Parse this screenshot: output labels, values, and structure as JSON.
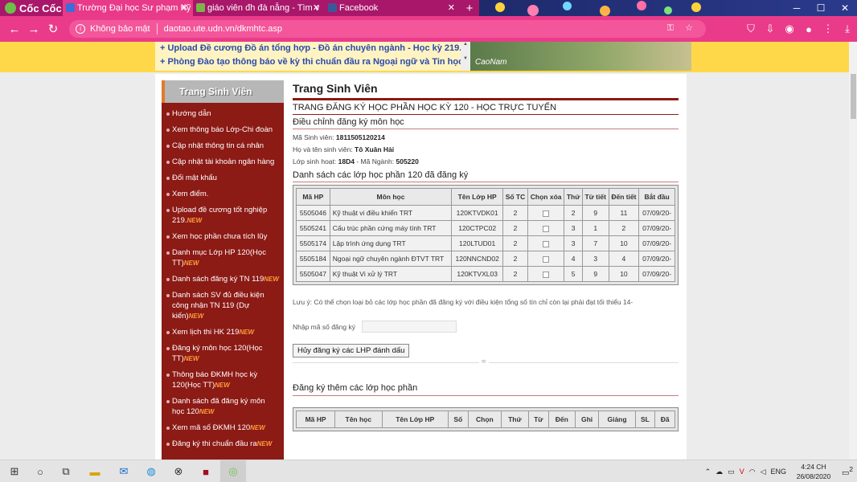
{
  "browser": {
    "brand": "Cốc Cốc",
    "tabs": [
      {
        "title": "Trường Đại học Sư phạm Kỹ t",
        "active": true,
        "icon_color": "#3a6ed8"
      },
      {
        "title": "giáo viên đh đà nẵng - Tìm v",
        "active": false,
        "icon_color": "#7ab648"
      },
      {
        "title": "Facebook",
        "active": false,
        "icon_color": "#3b5998"
      }
    ],
    "address": {
      "security_label": "Không bảo mật",
      "url": "daotao.ute.udn.vn/dkmhtc.asp"
    }
  },
  "banner": {
    "ticker": [
      "Upload Đề cương Đồ án tổng hợp - Đồ án chuyên ngành - Học kỳ 219.",
      "Phòng Đào tạo thông báo về kỳ thi chuẩn đầu ra Ngoại ngữ và Tin học đợ"
    ],
    "signature": "CaoNam"
  },
  "sidebar": {
    "title": "Trang Sinh Viên",
    "new_badge": "NEW",
    "items": [
      {
        "label": "Hướng dẫn",
        "new": false
      },
      {
        "label": "Xem thông báo Lớp-Chi đoàn",
        "new": false
      },
      {
        "label": "Cập nhật thông tin cá nhân",
        "new": false
      },
      {
        "label": "Cập nhật tài khoản ngân hàng",
        "new": false
      },
      {
        "label": "Đổi mật khẩu",
        "new": false
      },
      {
        "label": "Xem điểm.",
        "new": false
      },
      {
        "label": "Upload đề cương tốt nghiệp 219.",
        "new": true
      },
      {
        "label": "Xem học phần chưa tích lũy",
        "new": false
      },
      {
        "label": "Danh mục Lớp HP 120(Học TT)",
        "new": true
      },
      {
        "label": "Danh sách đăng ký TN 119",
        "new": true
      },
      {
        "label": "Danh sách SV đủ điều kiện công nhận TN 119 (Dự kiến)",
        "new": true
      },
      {
        "label": "Xem lịch thi HK 219",
        "new": true
      },
      {
        "label": "Đăng ký môn học 120(Học TT)",
        "new": true
      },
      {
        "label": "Thông báo ĐKMH học kỳ 120(Học TT)",
        "new": true
      },
      {
        "label": "Danh sách đã đăng ký môn học 120",
        "new": true
      },
      {
        "label": "Xem mã số ĐKMH 120",
        "new": true
      },
      {
        "label": "Đăng ký thi chuẩn đầu ra",
        "new": true
      }
    ]
  },
  "main": {
    "page_title": "Trang Sinh Viên",
    "subtitle": "TRANG ĐĂNG KÝ HỌC PHẦN HỌC KỲ 120 - HỌC TRỰC TUYẾN",
    "section_adjust": "Điều chỉnh đăng ký môn học",
    "student": {
      "id_label": "Mã Sinh viên:",
      "id": "1811505120214",
      "name_label": "Họ và tên sinh viên:",
      "name": "Tô Xuân Hải",
      "class_label": "Lớp sinh hoạt:",
      "class": "18D4",
      "major_label": "- Mã Ngành:",
      "major": "505220"
    },
    "registered_title": "Danh sách các lớp học phần 120 đã đăng ký",
    "registered_headers": [
      "Mã HP",
      "Môn học",
      "Tên Lớp HP",
      "Số TC",
      "Chọn xóa",
      "Thứ",
      "Từ tiết",
      "Đến tiết",
      "Bắt đầu"
    ],
    "registered_rows": [
      {
        "ma": "5505046",
        "mon": "Kỹ thuật vi điều khiển TRT",
        "lop": "120KTVDK01",
        "tc": "2",
        "thu": "2",
        "tu": "9",
        "den": "11",
        "bd": "07/09/20-"
      },
      {
        "ma": "5505241",
        "mon": "Cấu trúc phần cứng máy tính TRT",
        "lop": "120CTPC02",
        "tc": "2",
        "thu": "3",
        "tu": "1",
        "den": "2",
        "bd": "07/09/20-"
      },
      {
        "ma": "5505174",
        "mon": "Lập trình ứng dụng TRT",
        "lop": "120LTUD01",
        "tc": "2",
        "thu": "3",
        "tu": "7",
        "den": "10",
        "bd": "07/09/20-"
      },
      {
        "ma": "5505184",
        "mon": "Ngoại ngữ chuyên ngành ĐTVT TRT",
        "lop": "120NNCND02",
        "tc": "2",
        "thu": "4",
        "tu": "3",
        "den": "4",
        "bd": "07/09/20-"
      },
      {
        "ma": "5505047",
        "mon": "Kỹ thuật Vi xử lý TRT",
        "lop": "120KTVXL03",
        "tc": "2",
        "thu": "5",
        "tu": "9",
        "den": "10",
        "bd": "07/09/20-"
      }
    ],
    "note": "Lưu ý: Có thể chọn loại bỏ các lớp học phần đã đăng ký với điều kiện tổng số tín chỉ còn lại phải đạt tối thiểu 14-",
    "code_label": "Nhập mã số đăng ký",
    "cancel_button": "Hủy đăng ký các LHP đánh dấu",
    "divider_glyph": "≈",
    "add_title": "Đăng ký thêm các lớp học phần",
    "add_headers": [
      "Mã HP",
      "Tên học",
      "Tên Lớp HP",
      "Số",
      "Chọn",
      "Thứ",
      "Từ",
      "Đến",
      "Ghi",
      "Giảng",
      "SL",
      "Đã"
    ]
  },
  "taskbar": {
    "lang": "ENG",
    "time": "4:24 CH",
    "date": "26/08/2020",
    "notif": "2"
  }
}
